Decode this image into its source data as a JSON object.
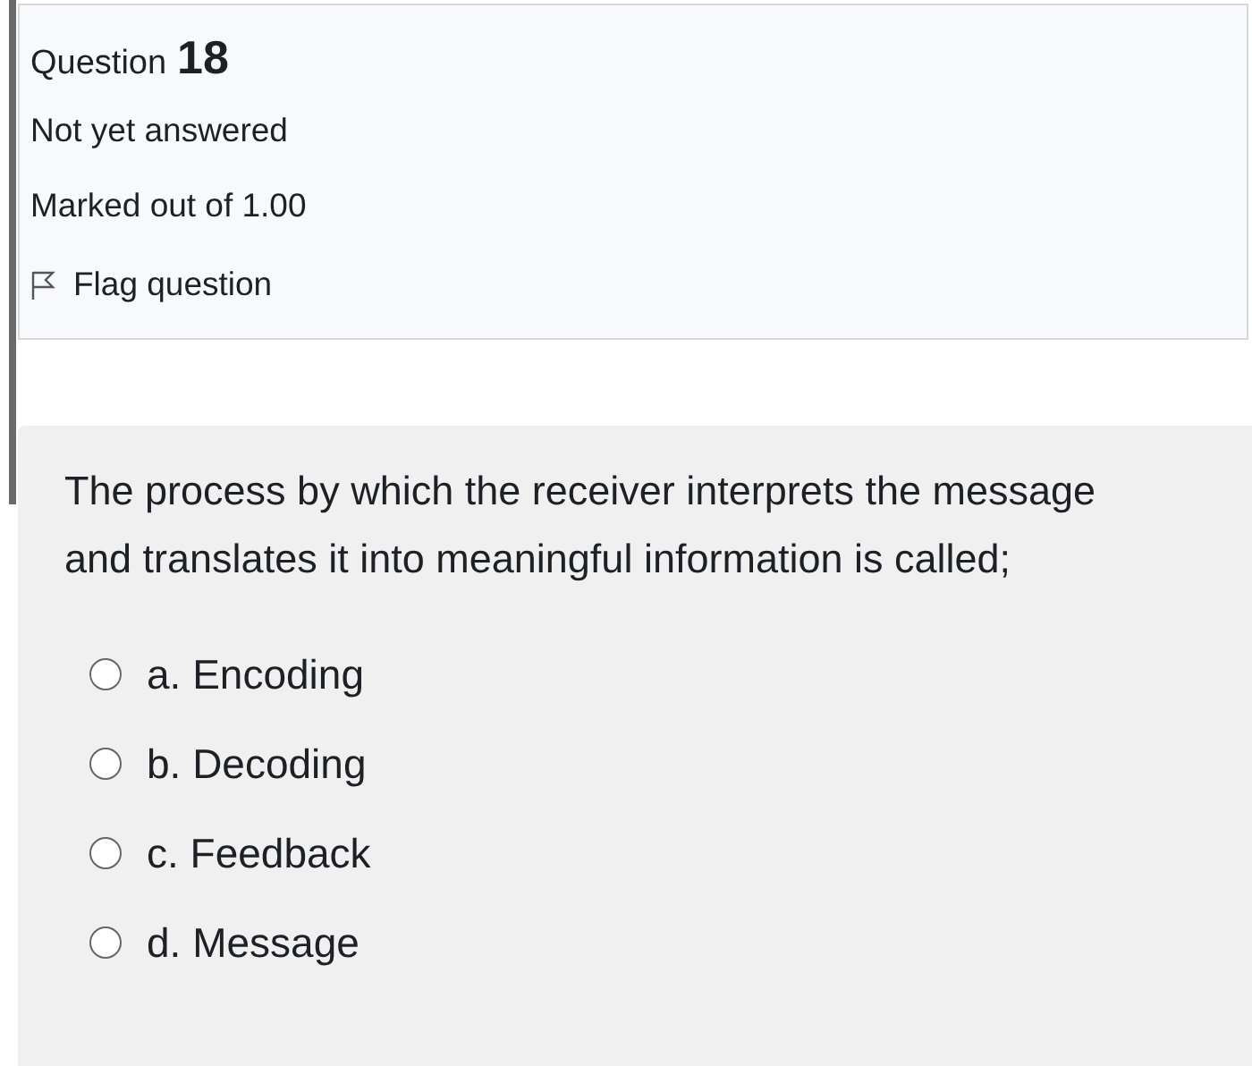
{
  "info": {
    "question_label": "Question",
    "question_number": "18",
    "status": "Not yet answered",
    "marks": "Marked out of 1.00",
    "flag": {
      "label": "Flag question",
      "flagged": false
    }
  },
  "question": {
    "text": "The process by which the receiver interprets the message and translates it into meaningful information is called;",
    "options": [
      {
        "label": "a. Encoding",
        "selected": false
      },
      {
        "label": "b. Decoding",
        "selected": false
      },
      {
        "label": "c. Feedback",
        "selected": false
      },
      {
        "label": "d. Message",
        "selected": false
      }
    ]
  }
}
